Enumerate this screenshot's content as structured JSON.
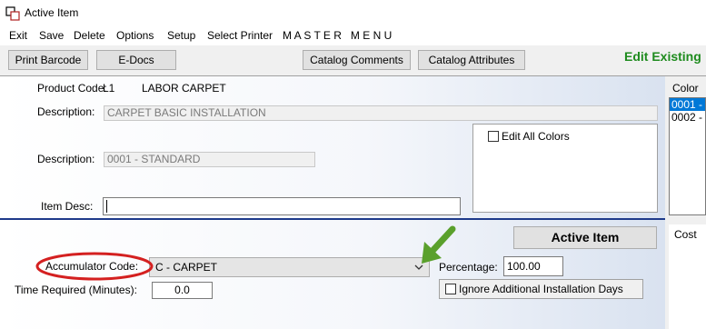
{
  "window": {
    "title": "Active Item",
    "icon": "app-window-icon"
  },
  "menu": [
    "Exit",
    "Save",
    "Delete",
    "Options",
    "Setup",
    "Select Printer",
    "M A S T E R   M E N U"
  ],
  "toolbar": {
    "print_barcode": "Print Barcode",
    "e_docs": "E-Docs",
    "catalog_comments": "Catalog Comments",
    "catalog_attributes": "Catalog Attributes",
    "mode": "Edit Existing"
  },
  "product": {
    "code_label": "Product Code:",
    "code": "L1",
    "name": "LABOR CARPET",
    "description_label": "Description:",
    "description": "CARPET BASIC INSTALLATION",
    "description2_label": "Description:",
    "description2": "0001 - STANDARD",
    "item_desc_label": "Item Desc:",
    "item_desc": "",
    "edit_all_colors": "Edit All Colors"
  },
  "colors": {
    "label": "Color",
    "items": [
      "0001 - ...",
      "0002 - ..."
    ],
    "selected": 0
  },
  "lower": {
    "active_item": "Active Item",
    "cost_label": "Cost",
    "accumulator_label": "Accumulator Code:",
    "accumulator_value": "C - CARPET",
    "percentage_label": "Percentage:",
    "percentage_value": "100.00",
    "time_label": "Time Required (Minutes):",
    "time_value": "0.0",
    "ignore_days": "Ignore Additional Installation Days"
  },
  "annotation_colors": {
    "circle": "#d42020",
    "arrow": "#5aa02c",
    "mode_text": "#1e8b1e",
    "divider": "#1e3a8a"
  }
}
